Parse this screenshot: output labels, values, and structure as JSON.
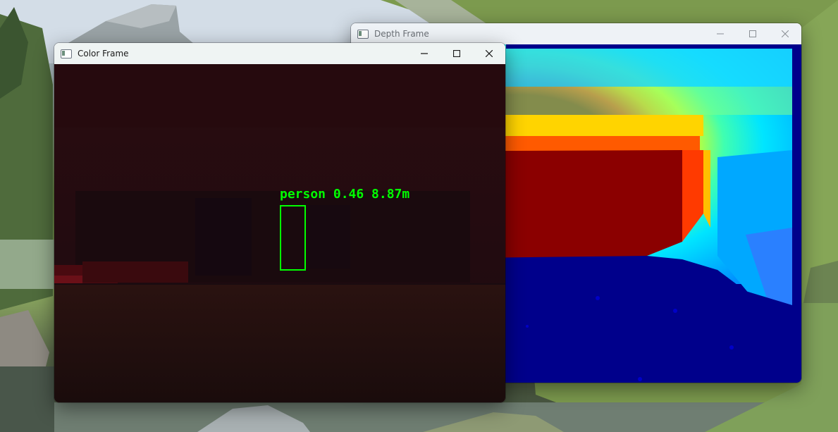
{
  "windows": {
    "depth": {
      "title": "Depth Frame"
    },
    "color": {
      "title": "Color Frame"
    }
  },
  "detection": {
    "label": "person 0.46 8.87m",
    "class": "person",
    "confidence": 0.46,
    "distance": "8.87m",
    "color": "#00ff00"
  },
  "icons": {
    "minimize": "minimize-icon",
    "maximize": "maximize-icon",
    "close": "close-icon",
    "app": "app-window-icon"
  },
  "colors": {
    "depth_near": "#8b0000",
    "depth_far": "#00008b",
    "depth_mid": "#00e5ff"
  }
}
